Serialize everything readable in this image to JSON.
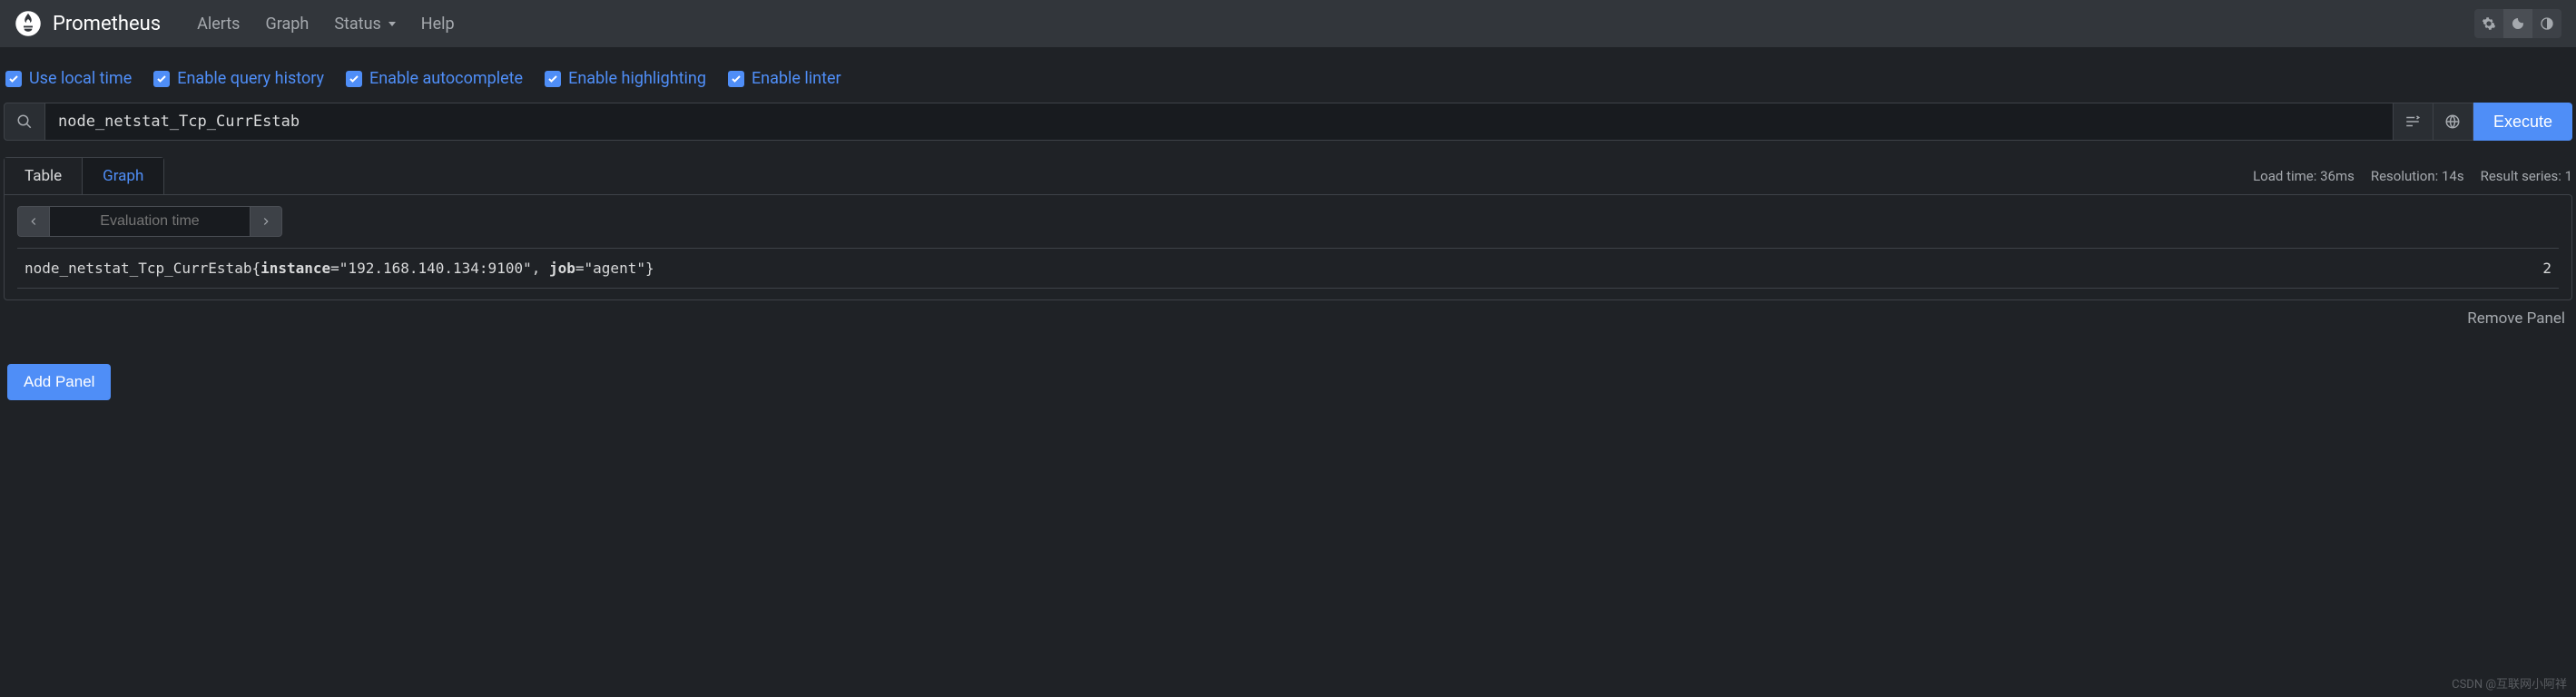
{
  "brand": "Prometheus",
  "nav": {
    "alerts": "Alerts",
    "graph": "Graph",
    "status": "Status",
    "help": "Help"
  },
  "options": {
    "use_local_time": "Use local time",
    "enable_query_history": "Enable query history",
    "enable_autocomplete": "Enable autocomplete",
    "enable_highlighting": "Enable highlighting",
    "enable_linter": "Enable linter"
  },
  "query": {
    "value": "node_netstat_Tcp_CurrEstab",
    "execute": "Execute"
  },
  "tabs": {
    "table": "Table",
    "graph": "Graph"
  },
  "stats": {
    "load_time": "Load time: 36ms",
    "resolution": "Resolution: 14s",
    "result_series": "Result series: 1"
  },
  "eval": {
    "placeholder": "Evaluation time"
  },
  "result": {
    "metric": "node_netstat_Tcp_CurrEstab",
    "labels": {
      "instance_key": "instance",
      "instance_val": "\"192.168.140.134:9100\"",
      "job_key": "job",
      "job_val": "\"agent\""
    },
    "value": "2"
  },
  "actions": {
    "remove_panel": "Remove Panel",
    "add_panel": "Add Panel"
  },
  "watermark": "CSDN @互联网小阿祥"
}
